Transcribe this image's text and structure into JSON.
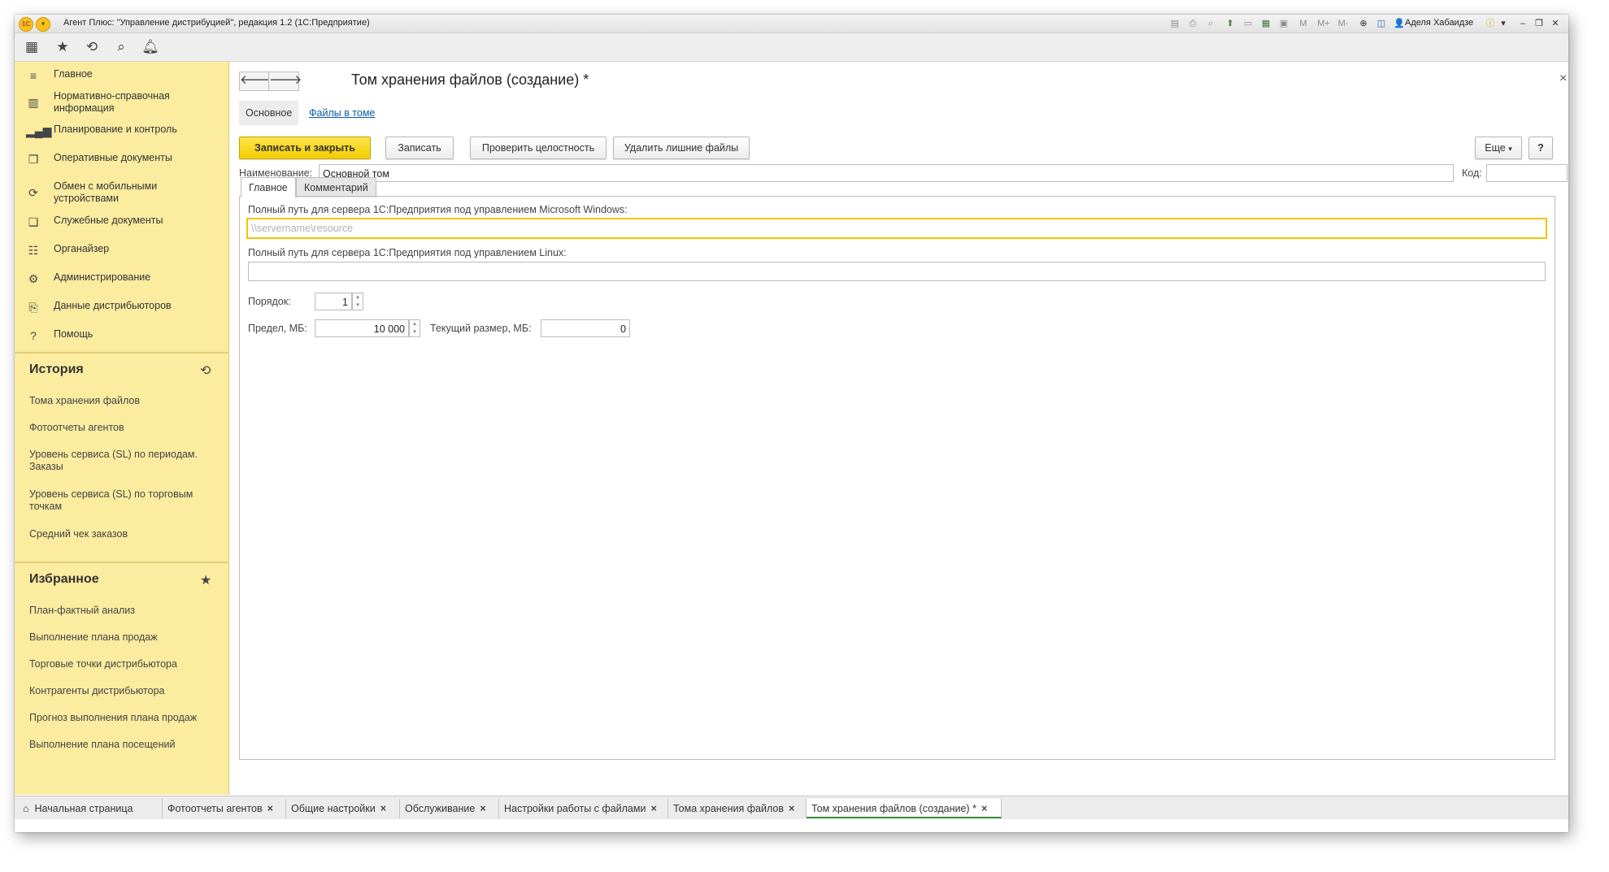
{
  "window": {
    "title": "Агент Плюс: \"Управление дистрибуцией\", редакция 1.2  (1С:Предприятие)",
    "user": "Аделя Хабаидзе",
    "logo_text": "1С"
  },
  "toolbar_icons": [
    "apps-grid-icon",
    "star-icon",
    "history-icon",
    "search-icon",
    "bell-icon"
  ],
  "sidebar": {
    "nav_items": [
      {
        "label": "Главное",
        "icon": "menu-icon"
      },
      {
        "label": "Нормативно-справочная информация",
        "icon": "catalog-icon"
      },
      {
        "label": "Планирование и контроль",
        "icon": "chart-icon"
      },
      {
        "label": "Оперативные документы",
        "icon": "documents-icon"
      },
      {
        "label": "Обмен с мобильными устройствами",
        "icon": "sync-icon"
      },
      {
        "label": "Служебные документы",
        "icon": "service-docs-icon"
      },
      {
        "label": "Органайзер",
        "icon": "organizer-icon"
      },
      {
        "label": "Администрирование",
        "icon": "gear-icon"
      },
      {
        "label": "Данные дистрибьюторов",
        "icon": "distributor-data-icon"
      },
      {
        "label": "Помощь",
        "icon": "help-icon"
      }
    ],
    "history": {
      "title": "История",
      "items": [
        "Тома хранения файлов",
        "Фотоотчеты агентов",
        "Уровень сервиса (SL) по периодам. Заказы",
        "Уровень сервиса (SL) по торговым точкам",
        "Средний чек заказов"
      ]
    },
    "favorites": {
      "title": "Избранное",
      "items": [
        "План-фактный анализ",
        "Выполнение плана продаж",
        "Торговые точки дистрибьютора",
        "Контрагенты дистрибьютора",
        "Прогноз выполнения плана продаж",
        "Выполнение плана посещений"
      ]
    }
  },
  "form": {
    "title": "Том хранения файлов (создание) *",
    "tabs": {
      "main": "Основное",
      "files": "Файлы в томе"
    },
    "buttons": {
      "save_close": "Записать и закрыть",
      "save": "Записать",
      "check": "Проверить целостность",
      "delete_extra": "Удалить лишние файлы",
      "more": "Еще",
      "help": "?"
    },
    "name_label": "Наименование:",
    "name_value": "Основной том",
    "code_label": "Код:",
    "code_value": "",
    "inner_tabs": {
      "main": "Главное",
      "comment": "Комментарий"
    },
    "windows_path_label": "Полный путь для сервера 1С:Предприятия под управлением Microsoft Windows:",
    "windows_path_placeholder": "\\\\servername\\resource",
    "linux_path_label": "Полный путь для сервера 1С:Предприятия под управлением Linux:",
    "linux_path_value": "",
    "order_label": "Порядок:",
    "order_value": "1",
    "limit_label": "Предел, МБ:",
    "limit_value": "10 000",
    "current_size_label": "Текущий размер, МБ:",
    "current_size_value": "0"
  },
  "bottom_tabs": [
    {
      "label": "Начальная страница",
      "closable": false
    },
    {
      "label": "Фотоотчеты агентов",
      "closable": true
    },
    {
      "label": "Общие настройки",
      "closable": true
    },
    {
      "label": "Обслуживание",
      "closable": true
    },
    {
      "label": "Настройки работы с файлами",
      "closable": true
    },
    {
      "label": "Тома хранения файлов",
      "closable": true
    },
    {
      "label": "Том хранения файлов (создание) *",
      "closable": true,
      "active": true
    }
  ],
  "colors": {
    "sidebar_bg": "#fbeca0",
    "primary_button": "#f3cc00",
    "link": "#0c5ba8",
    "active_tab_underline": "#3a8f3a"
  }
}
